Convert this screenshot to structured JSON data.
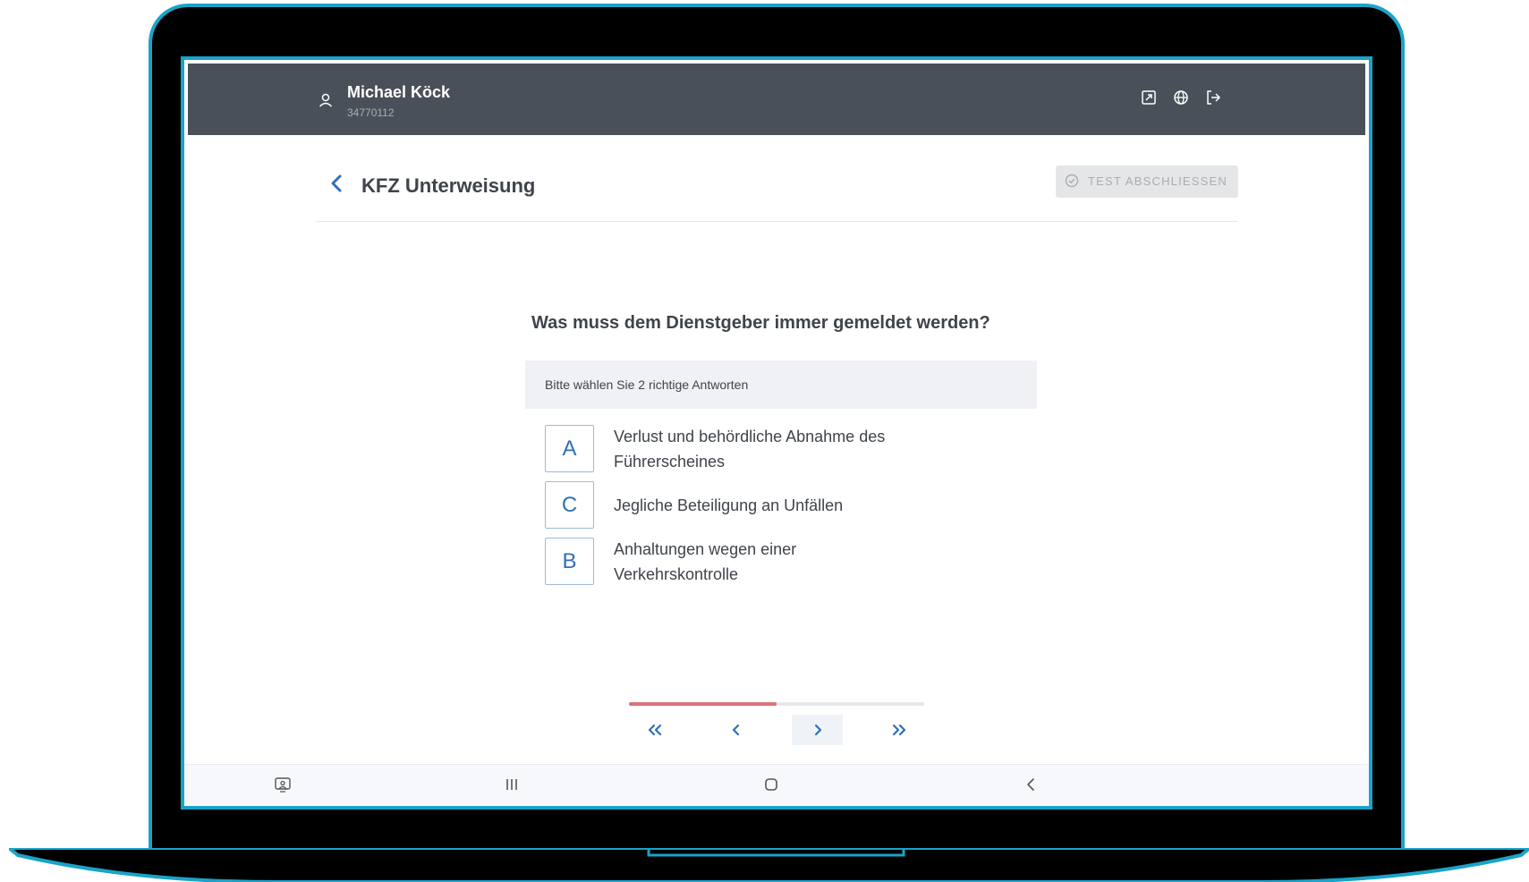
{
  "user": {
    "name": "Michael Köck",
    "id": "34770112"
  },
  "topbar_icons": [
    "expand-icon",
    "globe-icon",
    "logout-icon"
  ],
  "header": {
    "title": "KFZ Unterweisung",
    "finish_label": "TEST ABSCHLIESSEN"
  },
  "question": {
    "text": "Was muss dem Dienstgeber immer gemeldet werden?",
    "hint": "Bitte wählen Sie 2 richtige Antworten",
    "answers": [
      {
        "letter": "A",
        "text": "Verlust und behördliche Abnahme des Führerscheines"
      },
      {
        "letter": "C",
        "text": "Jegliche Beteiligung an Unfällen"
      },
      {
        "letter": "B",
        "text": "Anhaltungen wegen einer Verkehrskontrolle"
      }
    ]
  },
  "progress": {
    "fraction": 0.5
  },
  "nav": [
    "first-page-icon",
    "previous-icon",
    "next-icon",
    "last-page-icon"
  ],
  "sysbar": [
    "screenshot-icon",
    "recent-apps-icon",
    "home-icon",
    "system-back-icon"
  ],
  "colors": {
    "topbar": "#4a5059",
    "accent": "#2f6fb7",
    "progress": "#d9727b",
    "frame": "#1aa3c9"
  }
}
